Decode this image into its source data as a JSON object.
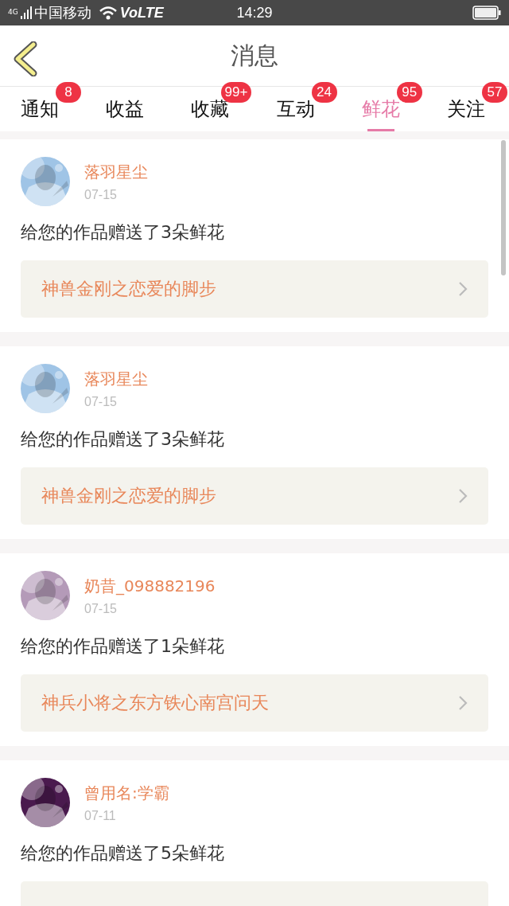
{
  "status_bar": {
    "network": "4G",
    "carrier": "中国移动",
    "volte": "VoLTE",
    "time": "14:29"
  },
  "header": {
    "title": "消息"
  },
  "tabs": [
    {
      "label": "通知",
      "badge": "8",
      "selected": false
    },
    {
      "label": "收益",
      "selected": false
    },
    {
      "label": "收藏",
      "badge": "99+",
      "selected": false
    },
    {
      "label": "互动",
      "badge": "24",
      "selected": false
    },
    {
      "label": "鲜花",
      "badge": "95",
      "selected": true
    },
    {
      "label": "关注",
      "badge": "57",
      "selected": false
    }
  ],
  "messages": [
    {
      "user": "落羽星尘",
      "date": "07-15",
      "text": "给您的作品赠送了3朵鲜花",
      "work": "神兽金刚之恋爱的脚步"
    },
    {
      "user": "落羽星尘",
      "date": "07-15",
      "text": "给您的作品赠送了3朵鲜花",
      "work": "神兽金刚之恋爱的脚步"
    },
    {
      "user": "奶昔_098882196",
      "date": "07-15",
      "text": "给您的作品赠送了1朵鲜花",
      "work": "神兵小将之东方铁心南宫问天"
    },
    {
      "user": "曾用名:学霸",
      "date": "07-11",
      "text": "给您的作品赠送了5朵鲜花"
    }
  ]
}
